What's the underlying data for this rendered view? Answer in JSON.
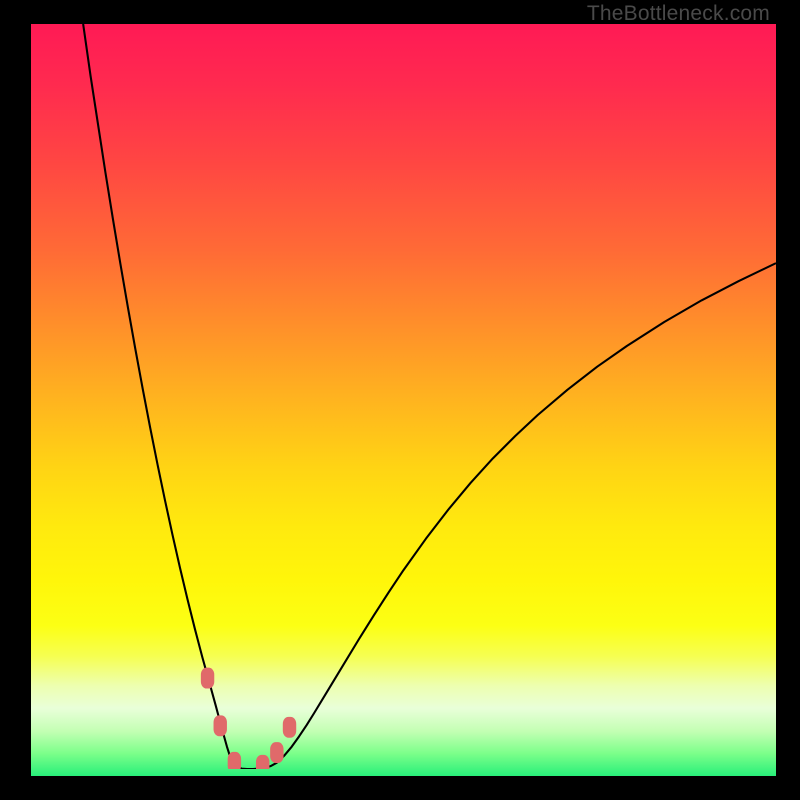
{
  "watermark": "TheBottleneck.com",
  "chart_data": {
    "type": "line",
    "title": "",
    "xlabel": "",
    "ylabel": "",
    "xlim": [
      0,
      100
    ],
    "ylim": [
      0,
      100
    ],
    "grid": false,
    "series": [
      {
        "name": "curve-left",
        "x": [
          7,
          8,
          9,
          10,
          11,
          12,
          13,
          14,
          15,
          16,
          17,
          18,
          19,
          20,
          21,
          22,
          23,
          24,
          24.8,
          25.6,
          26.3,
          27
        ],
        "y": [
          100,
          93,
          86.5,
          80,
          73.8,
          67.8,
          62,
          56.4,
          51,
          45.8,
          40.8,
          36,
          31.4,
          27,
          22.8,
          18.8,
          15,
          11.4,
          8.5,
          5.5,
          3,
          0.8
        ]
      },
      {
        "name": "curve-bottom",
        "x": [
          27,
          27.6,
          28.3,
          29,
          29.8,
          30.6,
          31.4,
          32.2,
          33
        ],
        "y": [
          0.8,
          0.25,
          0.05,
          0,
          0,
          0.05,
          0.15,
          0.4,
          0.85
        ]
      },
      {
        "name": "curve-right",
        "x": [
          33,
          34,
          35,
          36,
          37,
          38,
          40,
          42,
          44,
          46,
          48,
          50,
          53,
          56,
          59,
          62,
          65,
          68,
          72,
          76,
          80,
          85,
          90,
          95,
          100
        ],
        "y": [
          0.85,
          1.8,
          3,
          4.4,
          5.9,
          7.5,
          10.8,
          14.1,
          17.4,
          20.6,
          23.7,
          26.7,
          30.9,
          34.8,
          38.4,
          41.7,
          44.7,
          47.5,
          50.9,
          54,
          56.8,
          60,
          62.9,
          65.5,
          67.9
        ]
      }
    ],
    "markers": [
      {
        "x": 23.7,
        "y": 12.2
      },
      {
        "x": 25.4,
        "y": 5.8
      },
      {
        "x": 27.3,
        "y": 0.9
      },
      {
        "x": 31.1,
        "y": 0.5
      },
      {
        "x": 33.0,
        "y": 2.2
      },
      {
        "x": 34.7,
        "y": 5.6
      }
    ],
    "background": {
      "type": "vertical-gradient",
      "stops": [
        {
          "pos": 0,
          "color": "#ff1a55"
        },
        {
          "pos": 50,
          "color": "#ffb41f"
        },
        {
          "pos": 80,
          "color": "#fcff14"
        },
        {
          "pos": 100,
          "color": "#28ef7a"
        }
      ]
    }
  }
}
